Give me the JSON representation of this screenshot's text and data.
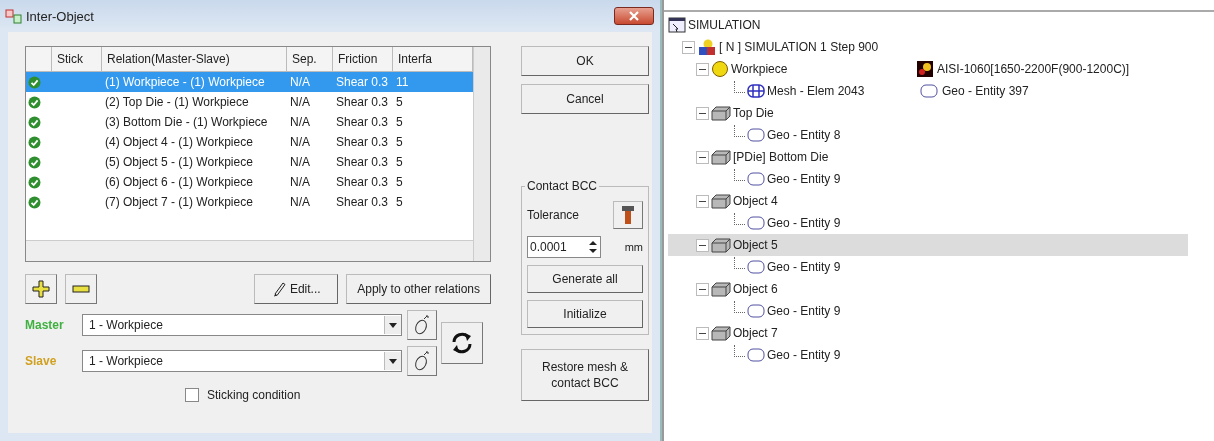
{
  "dialog": {
    "title": "Inter-Object"
  },
  "table": {
    "columns": [
      "",
      "Stick",
      "Relation(Master-Slave)",
      "Sep.",
      "Friction",
      "Interfa"
    ],
    "rows": [
      {
        "ok": true,
        "selected": true,
        "relation": "(1) Workpiece - (1) Workpiece",
        "sep": "N/A",
        "friction": "Shear 0.3",
        "interface": "11"
      },
      {
        "ok": true,
        "selected": false,
        "relation": "(2) Top Die - (1) Workpiece",
        "sep": "N/A",
        "friction": "Shear 0.3",
        "interface": "5"
      },
      {
        "ok": true,
        "selected": false,
        "relation": "(3) Bottom Die - (1) Workpiece",
        "sep": "N/A",
        "friction": "Shear 0.3",
        "interface": "5"
      },
      {
        "ok": true,
        "selected": false,
        "relation": "(4) Object 4 - (1) Workpiece",
        "sep": "N/A",
        "friction": "Shear 0.3",
        "interface": "5"
      },
      {
        "ok": true,
        "selected": false,
        "relation": "(5) Object 5 - (1) Workpiece",
        "sep": "N/A",
        "friction": "Shear 0.3",
        "interface": "5"
      },
      {
        "ok": true,
        "selected": false,
        "relation": "(6) Object 6 - (1) Workpiece",
        "sep": "N/A",
        "friction": "Shear 0.3",
        "interface": "5"
      },
      {
        "ok": true,
        "selected": false,
        "relation": "(7) Object 7 - (1) Workpiece",
        "sep": "N/A",
        "friction": "Shear 0.3",
        "interface": "5"
      }
    ]
  },
  "edit_button": "Edit...",
  "apply_button": "Apply to other relations",
  "master": {
    "label": "Master",
    "value": "1 - Workpiece"
  },
  "slave": {
    "label": "Slave",
    "value": "1 - Workpiece"
  },
  "sticking": {
    "label": "Sticking condition",
    "checked": false
  },
  "ok_button": "OK",
  "cancel_button": "Cancel",
  "contact_bcc": {
    "title": "Contact BCC",
    "tolerance_label": "Tolerance",
    "tolerance": "0.0001",
    "unit": "mm",
    "generate_button": "Generate all",
    "initialize_button": "Initialize"
  },
  "restore_button": "Restore mesh & contact BCC",
  "tree": {
    "root": "SIMULATION",
    "step": {
      "label": "[ N ]  SIMULATION 1  Step 900",
      "expanded": true
    },
    "objects": [
      {
        "kind": "workpiece",
        "label": "Workpiece",
        "expanded": true,
        "selected": false,
        "aside": "AISI-1060[1650-2200F(900-1200C)]",
        "children": [
          {
            "kind": "mesh",
            "label": "Mesh - Elem 2043",
            "aside": "Geo - Entity 397"
          }
        ]
      },
      {
        "kind": "die",
        "label": "Top Die",
        "expanded": true,
        "selected": false,
        "children": [
          {
            "kind": "geo",
            "label": "Geo - Entity 8"
          }
        ]
      },
      {
        "kind": "die",
        "label": "[PDie] Bottom Die",
        "expanded": true,
        "selected": false,
        "children": [
          {
            "kind": "geo",
            "label": "Geo - Entity 9"
          }
        ]
      },
      {
        "kind": "die",
        "label": "Object 4",
        "expanded": true,
        "selected": false,
        "children": [
          {
            "kind": "geo",
            "label": "Geo - Entity 9"
          }
        ]
      },
      {
        "kind": "die",
        "label": "Object 5",
        "expanded": true,
        "selected": true,
        "children": [
          {
            "kind": "geo",
            "label": "Geo - Entity 9"
          }
        ]
      },
      {
        "kind": "die",
        "label": "Object 6",
        "expanded": true,
        "selected": false,
        "children": [
          {
            "kind": "geo",
            "label": "Geo - Entity 9"
          }
        ]
      },
      {
        "kind": "die",
        "label": "Object 7",
        "expanded": true,
        "selected": false,
        "children": [
          {
            "kind": "geo",
            "label": "Geo - Entity 9"
          }
        ]
      }
    ]
  }
}
